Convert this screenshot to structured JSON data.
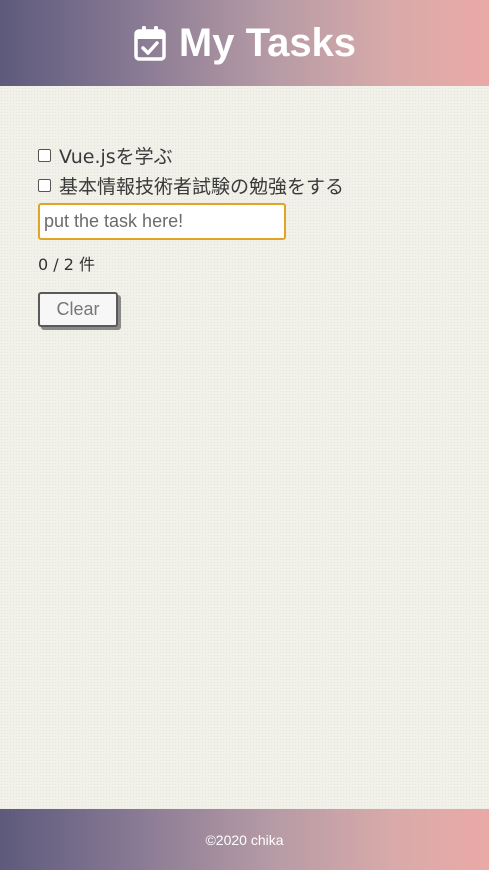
{
  "header": {
    "title": "My Tasks",
    "icon": "calendar-check-icon"
  },
  "tasks": [
    {
      "label": "Vue.jsを学ぶ",
      "checked": false
    },
    {
      "label": "基本情報技術者試験の勉強をする",
      "checked": false
    }
  ],
  "input": {
    "placeholder": "put the task here!",
    "value": ""
  },
  "counter": {
    "text": "0 / 2 件"
  },
  "clear_button": {
    "label": "Clear"
  },
  "footer": {
    "text": "©2020 chika"
  },
  "colors": {
    "header_gradient_start": "#5e5a7c",
    "header_gradient_end": "#eaa9a6",
    "input_border": "#e3a325",
    "background": "#f1f1ea"
  }
}
